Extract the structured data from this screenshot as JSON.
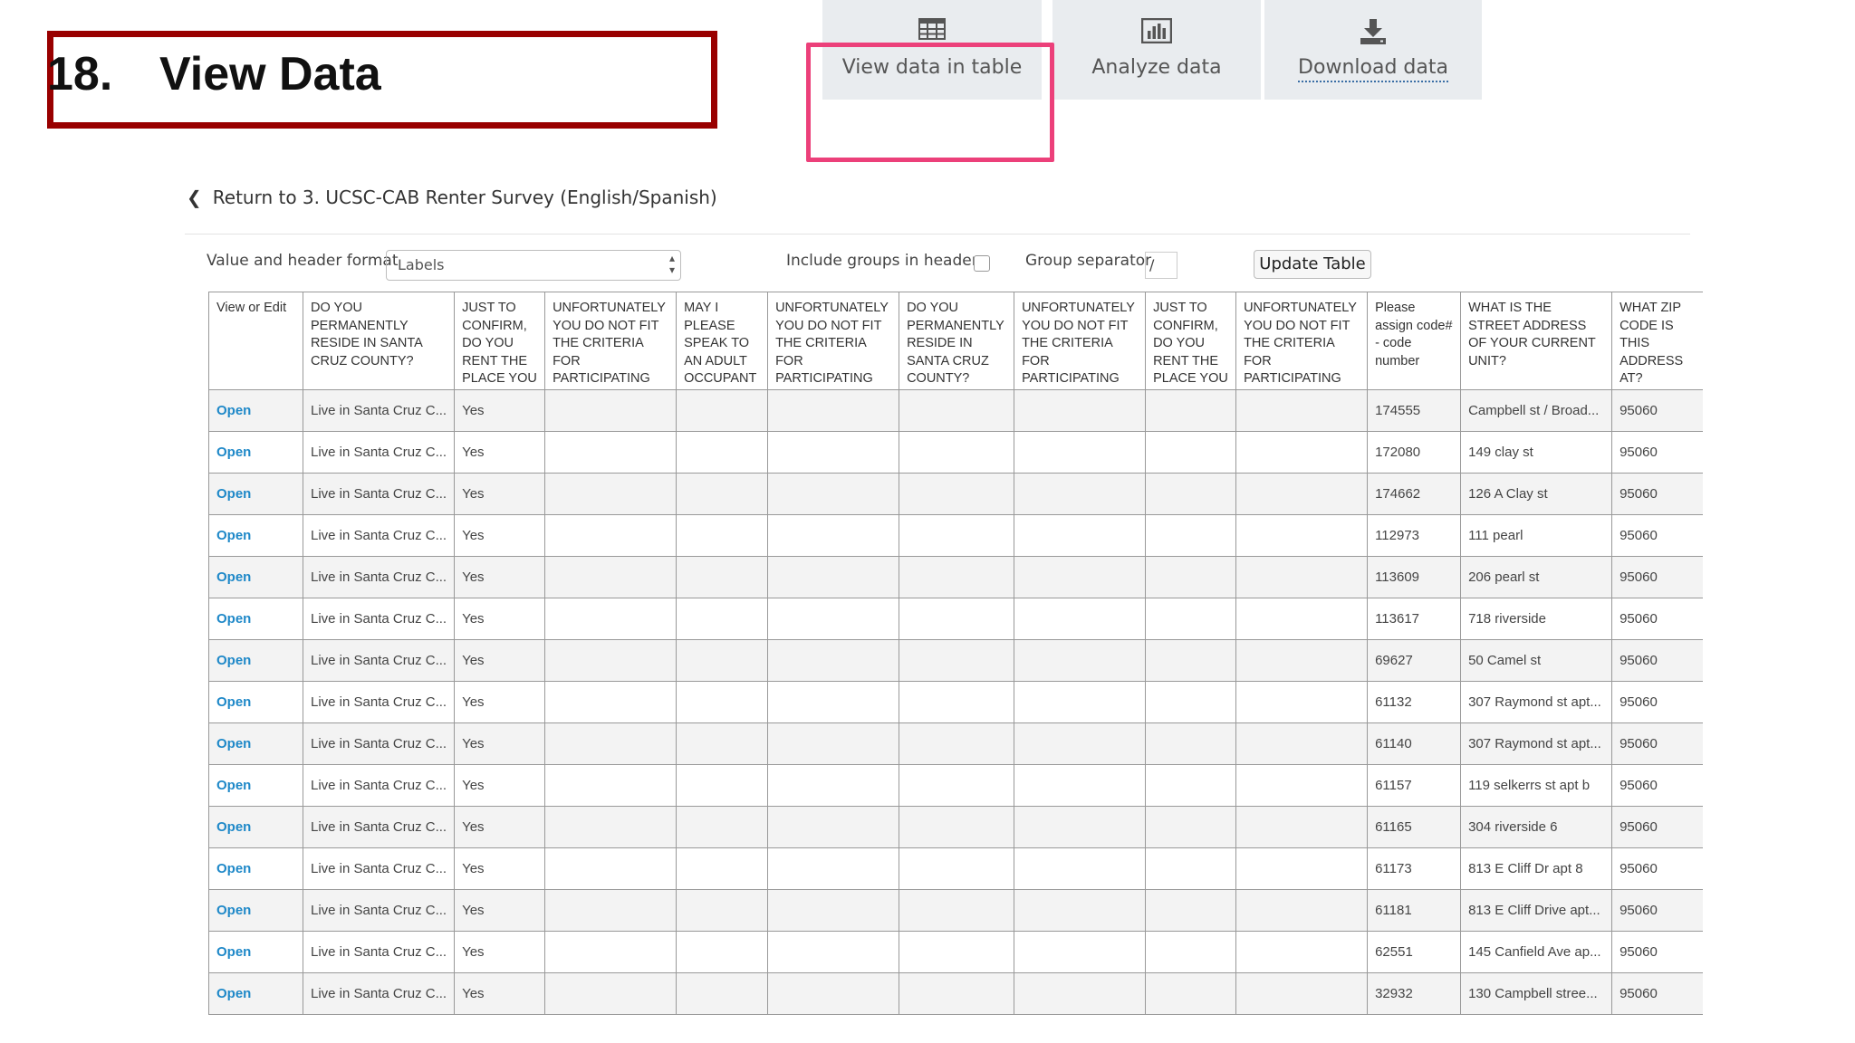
{
  "title": {
    "number": "18.",
    "text": "View Data"
  },
  "tabs": [
    {
      "label": "View data in table",
      "icon": "table-icon"
    },
    {
      "label": "Analyze data",
      "icon": "bar-chart-icon"
    },
    {
      "label": "Download data",
      "icon": "download-icon"
    }
  ],
  "return_link": {
    "text": "Return to 3. UCSC-CAB Renter Survey (English/Spanish)"
  },
  "controls": {
    "format_label": "Value and header format",
    "format_value": "Labels",
    "include_groups_label": "Include groups in headers",
    "group_separator_label": "Group separator",
    "group_separator_value": "/",
    "update_button": "Update Table"
  },
  "table": {
    "headers": [
      "View or Edit",
      "DO YOU PERMANENTLY RESIDE IN SANTA CRUZ COUNTY?",
      "JUST TO CONFIRM, DO YOU RENT THE PLACE YOU",
      "UNFORTUNATELY YOU DO NOT FIT THE CRITERIA FOR PARTICIPATING",
      "MAY I PLEASE SPEAK TO AN ADULT OCCUPANT",
      "UNFORTUNATELY YOU DO NOT FIT THE CRITERIA FOR PARTICIPATING",
      "DO YOU PERMANENTLY RESIDE IN SANTA CRUZ COUNTY?",
      "UNFORTUNATELY YOU DO NOT FIT THE CRITERIA FOR PARTICIPATING",
      "JUST TO CONFIRM, DO YOU RENT THE PLACE YOU",
      "UNFORTUNATELY YOU DO NOT FIT THE CRITERIA FOR PARTICIPATING",
      "Please assign code# - code number",
      "WHAT IS THE STREET ADDRESS OF YOUR CURRENT UNIT?",
      "WHAT ZIP CODE IS THIS ADDRESS AT?"
    ],
    "rows": [
      [
        "Open",
        "Live in Santa Cruz C...",
        "Yes",
        "",
        "",
        "",
        "",
        "",
        "",
        "",
        "174555",
        "Campbell st / Broad...",
        "95060"
      ],
      [
        "Open",
        "Live in Santa Cruz C...",
        "Yes",
        "",
        "",
        "",
        "",
        "",
        "",
        "",
        "172080",
        "149 clay st",
        "95060"
      ],
      [
        "Open",
        "Live in Santa Cruz C...",
        "Yes",
        "",
        "",
        "",
        "",
        "",
        "",
        "",
        "174662",
        "126 A Clay st",
        "95060"
      ],
      [
        "Open",
        "Live in Santa Cruz C...",
        "Yes",
        "",
        "",
        "",
        "",
        "",
        "",
        "",
        "112973",
        "111 pearl",
        "95060"
      ],
      [
        "Open",
        "Live in Santa Cruz C...",
        "Yes",
        "",
        "",
        "",
        "",
        "",
        "",
        "",
        "113609",
        "206 pearl st",
        "95060"
      ],
      [
        "Open",
        "Live in Santa Cruz C...",
        "Yes",
        "",
        "",
        "",
        "",
        "",
        "",
        "",
        "113617",
        "718 riverside",
        "95060"
      ],
      [
        "Open",
        "Live in Santa Cruz C...",
        "Yes",
        "",
        "",
        "",
        "",
        "",
        "",
        "",
        "69627",
        "50 Camel st",
        "95060"
      ],
      [
        "Open",
        "Live in Santa Cruz C...",
        "Yes",
        "",
        "",
        "",
        "",
        "",
        "",
        "",
        "61132",
        "307 Raymond st apt...",
        "95060"
      ],
      [
        "Open",
        "Live in Santa Cruz C...",
        "Yes",
        "",
        "",
        "",
        "",
        "",
        "",
        "",
        "61140",
        "307 Raymond st apt...",
        "95060"
      ],
      [
        "Open",
        "Live in Santa Cruz C...",
        "Yes",
        "",
        "",
        "",
        "",
        "",
        "",
        "",
        "61157",
        "119 selkerrs st apt b",
        "95060"
      ],
      [
        "Open",
        "Live in Santa Cruz C...",
        "Yes",
        "",
        "",
        "",
        "",
        "",
        "",
        "",
        "61165",
        "304 riverside 6",
        "95060"
      ],
      [
        "Open",
        "Live in Santa Cruz C...",
        "Yes",
        "",
        "",
        "",
        "",
        "",
        "",
        "",
        "61173",
        "813 E Cliff Dr apt 8",
        "95060"
      ],
      [
        "Open",
        "Live in Santa Cruz C...",
        "Yes",
        "",
        "",
        "",
        "",
        "",
        "",
        "",
        "61181",
        "813 E Cliff Drive apt...",
        "95060"
      ],
      [
        "Open",
        "Live in Santa Cruz C...",
        "Yes",
        "",
        "",
        "",
        "",
        "",
        "",
        "",
        "62551",
        "145 Canfield Ave ap...",
        "95060"
      ],
      [
        "Open",
        "Live in Santa Cruz C...",
        "Yes",
        "",
        "",
        "",
        "",
        "",
        "",
        "",
        "32932",
        "130 Campbell stree...",
        "95060"
      ]
    ]
  }
}
